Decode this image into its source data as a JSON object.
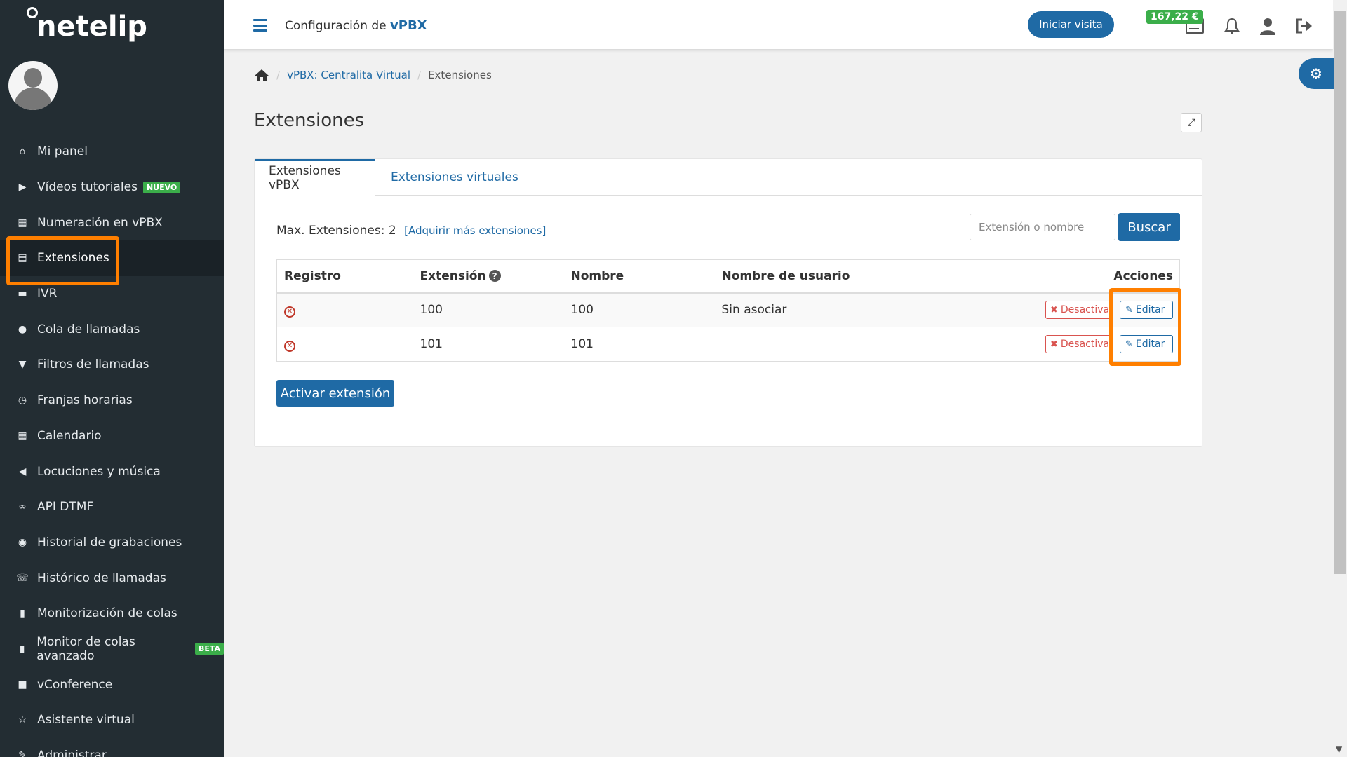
{
  "app": {
    "logo_text": "netelip"
  },
  "sidebar": {
    "items": [
      {
        "label": "Mi panel",
        "icon": "home-icon",
        "glyph": "⌂"
      },
      {
        "label": "Vídeos tutoriales",
        "icon": "video-icon",
        "glyph": "▶",
        "badge": "NUEVO"
      },
      {
        "label": "Numeración en vPBX",
        "icon": "grid-icon",
        "glyph": "▦"
      },
      {
        "label": "Extensiones",
        "icon": "list-icon",
        "glyph": "▤",
        "active": true
      },
      {
        "label": "IVR",
        "icon": "chat-icon",
        "glyph": "▬"
      },
      {
        "label": "Cola de llamadas",
        "icon": "user-icon",
        "glyph": "●"
      },
      {
        "label": "Filtros de llamadas",
        "icon": "filter-icon",
        "glyph": "▼"
      },
      {
        "label": "Franjas horarias",
        "icon": "clock-icon",
        "glyph": "◷"
      },
      {
        "label": "Calendario",
        "icon": "calendar-icon",
        "glyph": "▦"
      },
      {
        "label": "Locuciones y música",
        "icon": "speaker-icon",
        "glyph": "◀"
      },
      {
        "label": "API DTMF",
        "icon": "link-icon",
        "glyph": "∞"
      },
      {
        "label": "Historial de grabaciones",
        "icon": "record-icon",
        "glyph": "◉"
      },
      {
        "label": "Histórico de llamadas",
        "icon": "phone-icon",
        "glyph": "☏"
      },
      {
        "label": "Monitorización de colas",
        "icon": "bar-chart-icon",
        "glyph": "▮"
      },
      {
        "label": "Monitor de colas avanzado",
        "icon": "bar-chart-icon",
        "glyph": "▮",
        "badge": "BETA"
      },
      {
        "label": "vConference",
        "icon": "camera-icon",
        "glyph": "■"
      },
      {
        "label": "Asistente virtual",
        "icon": "star-icon",
        "glyph": "☆"
      },
      {
        "label": "Administrar",
        "icon": "edit-icon",
        "glyph": "✎"
      }
    ]
  },
  "header": {
    "title_prefix": "Configuración de",
    "title_bold": "vPBX",
    "visit_button": "Iniciar visita",
    "credit": "167,22 €"
  },
  "breadcrumb": {
    "section": "vPBX: Centralita Virtual",
    "current": "Extensiones"
  },
  "page": {
    "title": "Extensiones"
  },
  "tabs": [
    {
      "label": "Extensiones vPBX",
      "active": true
    },
    {
      "label": "Extensiones virtuales",
      "active": false
    }
  ],
  "toolbar": {
    "max_label": "Max. Extensiones: 2",
    "acquire_link": "[Adquirir más extensiones]",
    "search_placeholder": "Extensión o nombre",
    "search_button": "Buscar"
  },
  "table": {
    "columns": [
      "Registro",
      "Extensión",
      "Nombre",
      "Nombre de usuario",
      "Acciones"
    ],
    "help_glyph": "?",
    "rows": [
      {
        "status": "not-registered",
        "extension": "100",
        "name": "100",
        "user": "Sin asociar"
      },
      {
        "status": "not-registered",
        "extension": "101",
        "name": "101",
        "user": ""
      }
    ],
    "deactivate_label": "Desactivar",
    "edit_label": "Editar"
  },
  "activate_button": "Activar extensión",
  "colors": {
    "accent": "#1f6aa5",
    "highlight": "#ff7f00",
    "sidebar": "#232d33",
    "success": "#3bae4a",
    "danger": "#d9534f"
  }
}
